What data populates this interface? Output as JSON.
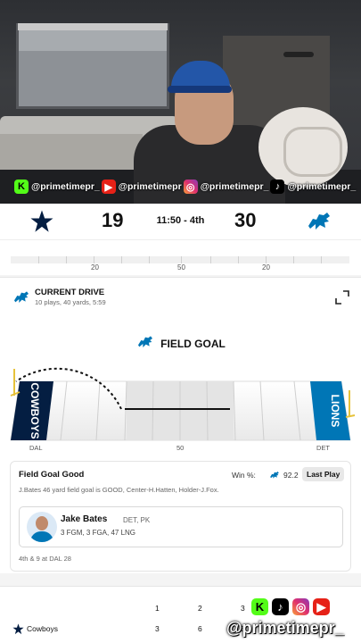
{
  "stream_overlay": {
    "handles": [
      {
        "icon": "kick-icon",
        "text": "@primetimepr_"
      },
      {
        "icon": "youtube-icon",
        "text": "@primetimepr"
      },
      {
        "icon": "instagram-icon",
        "text": "@primetimepr_"
      },
      {
        "icon": "tiktok-icon",
        "text": "@primetimepr_"
      }
    ],
    "bottom_handle": "@primetimepr_"
  },
  "scoreboard": {
    "home_team": "Cowboys",
    "home_score": "19",
    "away_score": "30",
    "clock": "11:50 - 4th",
    "colors": {
      "cowboys": "#041e42",
      "lions": "#0076b6"
    }
  },
  "mini_field": {
    "yard_labels": [
      "20",
      "50",
      "20"
    ]
  },
  "drive": {
    "title": "CURRENT DRIVE",
    "subtitle": "10 plays, 40 yards, 5:59"
  },
  "field_goal": {
    "heading": "FIELD GOAL",
    "left_endzone": "COWBOYS",
    "right_endzone": "LIONS",
    "yard_labels": [
      "DAL",
      "50",
      "DET"
    ]
  },
  "last_play": {
    "title": "Field Goal Good",
    "win_label": "Win %:",
    "win_value": "92.2",
    "button": "Last Play",
    "description": "J.Bates 46 yard field goal is GOOD, Center-H.Hatten, Holder-J.Fox.",
    "player": {
      "name": "Jake Bates",
      "position": "DET, PK",
      "stats": "3 FGM, 3 FGA, 47 LNG"
    },
    "situation": "4th & 9 at DAL 28"
  },
  "quarters": {
    "headers": [
      "1",
      "2",
      "3"
    ],
    "rows": [
      {
        "team": "Cowboys",
        "values": [
          "3",
          "6",
          "3"
        ]
      }
    ]
  }
}
